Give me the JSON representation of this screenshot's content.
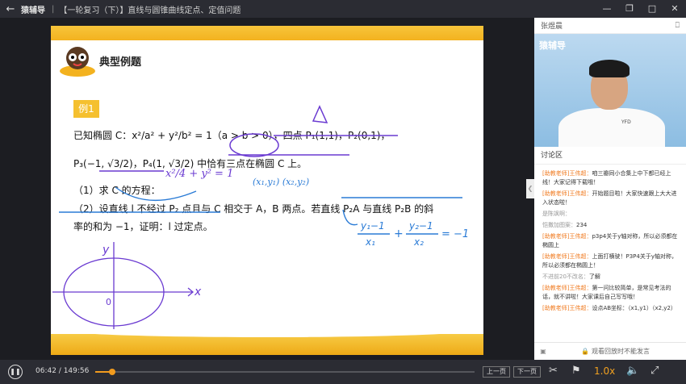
{
  "titlebar": {
    "back_icon": "arrow-left-icon",
    "brand": "猿辅导",
    "separator": "|",
    "course": "【一轮复习（下）】直线与圆锥曲线定点、定值问题",
    "min_icon": "minimize-icon",
    "restore_icon": "restore-icon",
    "max_icon": "maximize-icon",
    "close_icon": "close-icon"
  },
  "slide": {
    "heading": "典型例题",
    "badge": "例1",
    "line1": "已知椭圆 C：x²/a² + y²/b² = 1（a > b > 0），四点 P₁(1,1)，P₂(0,1)，",
    "line2": "P₃(−1, √3/2)，P₄(1, √3/2) 中恰有三点在椭圆 C 上。",
    "line3": "（1）求 C 的方程：",
    "line4": "（2）设直线 l 不经过 P₂ 点且与 C 相交于 A，B 两点。若直线 P₂A 与直线 P₂B 的斜",
    "line5": "率的和为 −1，证明：l 过定点。",
    "hand_eq1": "x²/4 + y² = 1",
    "hand_pts": "(x₁,y₁) (x₂,y₂)",
    "hand_eq2_num1": "y₁−1",
    "hand_eq2_den1": "x₁",
    "hand_eq2_num2": "y₂−1",
    "hand_eq2_den2": "x₂",
    "hand_eq2_rhs": "= −1",
    "axis_y": "y",
    "axis_x": "x",
    "origin": "0"
  },
  "side": {
    "teacher": "张煜晨",
    "camera_icon": "camera-off-icon",
    "video_logo": "猿辅导",
    "shirt_tag": "YFD",
    "discussion": "讨论区",
    "messages": [
      {
        "who": "[助教老师]王伟超：",
        "text": "咱三瓣同小合集上中下都已经上线！大家记得下载哦！"
      },
      {
        "who": "[助教老师]王伟超：",
        "text": "开始题目啦！大家快速跟上大大进入状态啦！"
      },
      {
        "whoA": "是陈飒啊：",
        "text": ""
      },
      {
        "whoA": "恺撒加图案：",
        "text": "234"
      },
      {
        "who": "[助教老师]王伟超：",
        "text": "p3p4关于y轴对称，所以必须都在椭圆上"
      },
      {
        "who": "[助教老师]王伟超：",
        "text": "上面打横驶！P3P4关于y轴对称，所以必须都在椭圆上！"
      },
      {
        "whoA": "不进前20不改名：",
        "text": "了解"
      },
      {
        "who": "[助教老师]王伟超：",
        "text": "第一问比较简单，是常见考法的话，就不讲啦！大家课后自己写写哦！"
      },
      {
        "who": "[助教老师]王伟超：",
        "text": "设点AB坐标：（x1,y1）（x2,y2）"
      }
    ],
    "image_icon": "image-icon",
    "lock_notice": "观看回放时不能发言",
    "lock_icon": "lock-icon",
    "collapse_icon": "chevron-left-icon"
  },
  "controls": {
    "pause_icon": "pause-icon",
    "time": "06:42 / 149:56",
    "progress": 0.045,
    "prev": "上一页",
    "next": "下一页",
    "scissors_icon": "scissors-icon",
    "flag_icon": "flag-icon",
    "speed": "1.0x",
    "volume_icon": "volume-icon",
    "fullscreen_icon": "fullscreen-icon"
  }
}
